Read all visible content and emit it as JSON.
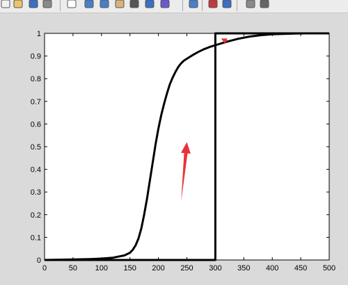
{
  "toolbar": {
    "icons": [
      "new-figure-icon",
      "open-file-icon",
      "save-icon",
      "print-icon",
      "edit-plot-arrow-icon",
      "zoom-in-icon",
      "zoom-out-icon",
      "pan-hand-icon",
      "rotate-3d-icon",
      "data-cursor-icon",
      "brush-icon",
      "link-plot-icon",
      "colorbar-icon",
      "legend-icon",
      "hide-plot-tools-icon",
      "show-plot-tools-icon"
    ]
  },
  "chart_data": {
    "type": "line",
    "title": "",
    "xlabel": "",
    "ylabel": "",
    "xlim": [
      0,
      500
    ],
    "ylim": [
      0,
      1
    ],
    "xticks": [
      "0",
      "50",
      "100",
      "150",
      "200",
      "250",
      "300",
      "350",
      "400",
      "450",
      "500"
    ],
    "yticks": [
      "0",
      "0.1",
      "0.2",
      "0.3",
      "0.4",
      "0.5",
      "0.6",
      "0.7",
      "0.8",
      "0.9",
      "1"
    ],
    "grid": false,
    "series": [
      {
        "color": "#000000",
        "x": [
          0,
          50,
          80,
          100,
          120,
          140,
          150,
          155,
          160,
          165,
          170,
          175,
          180,
          185,
          190,
          195,
          200,
          205,
          210,
          215,
          220,
          225,
          230,
          235,
          240,
          245,
          250,
          255,
          260,
          270,
          280,
          290,
          300,
          320,
          340,
          360,
          380,
          400,
          420,
          440,
          460,
          480,
          500
        ],
        "y": [
          0,
          0.002,
          0.004,
          0.006,
          0.01,
          0.02,
          0.032,
          0.045,
          0.065,
          0.095,
          0.14,
          0.2,
          0.27,
          0.35,
          0.43,
          0.51,
          0.58,
          0.64,
          0.69,
          0.735,
          0.775,
          0.805,
          0.83,
          0.852,
          0.868,
          0.88,
          0.888,
          0.896,
          0.904,
          0.918,
          0.93,
          0.94,
          0.948,
          0.963,
          0.976,
          0.986,
          0.992,
          0.996,
          0.998,
          0.999,
          1,
          1,
          1
        ]
      },
      {
        "color": "#000000",
        "x": [
          0,
          300,
          300,
          500
        ],
        "y": [
          0,
          0,
          1,
          1
        ]
      }
    ],
    "annotations": [
      {
        "type": "arrow",
        "color": "#e8333a",
        "from": [
          240,
          0.26
        ],
        "to": [
          250,
          0.52
        ]
      },
      {
        "type": "arrowhead",
        "color": "#e8333a",
        "at": [
          315,
          0.965
        ]
      }
    ],
    "colors": {
      "figure_bg": "#dadada",
      "axes_bg": "#ffffff",
      "toolbar_bg": "#ececec"
    }
  }
}
